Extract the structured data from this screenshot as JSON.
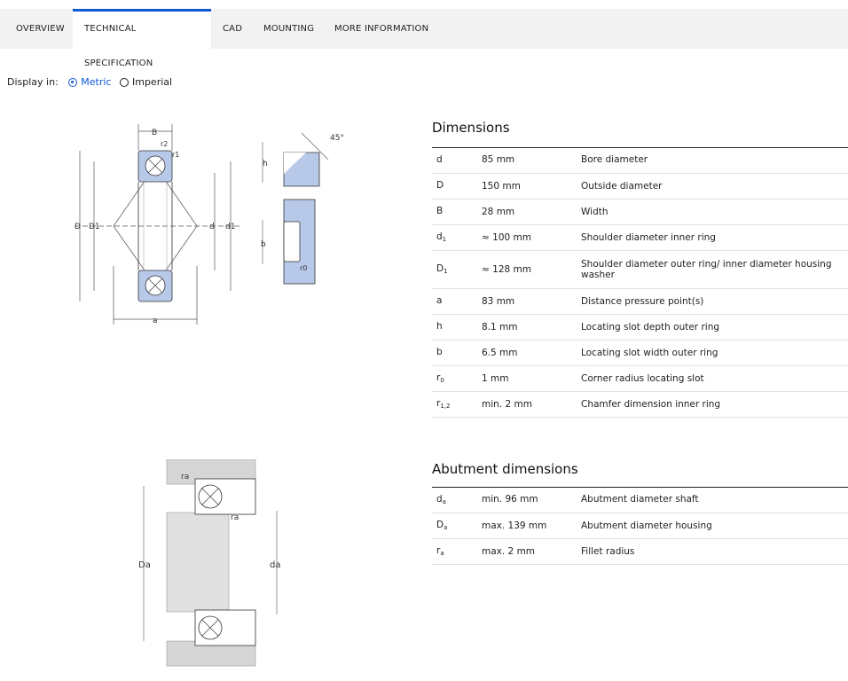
{
  "tabs": [
    {
      "label": "OVERVIEW",
      "active": false
    },
    {
      "label": "TECHNICAL SPECIFICATION",
      "active": true
    },
    {
      "label": "CAD",
      "active": false
    },
    {
      "label": "MOUNTING",
      "active": false
    },
    {
      "label": "MORE INFORMATION",
      "active": false
    }
  ],
  "display": {
    "label": "Display in:",
    "options": [
      {
        "label": "Metric",
        "selected": true
      },
      {
        "label": "Imperial",
        "selected": false
      }
    ]
  },
  "dimensions": {
    "title": "Dimensions",
    "rows": [
      {
        "sym": "d",
        "sub": "",
        "value": "85 mm",
        "desc": "Bore diameter"
      },
      {
        "sym": "D",
        "sub": "",
        "value": "150 mm",
        "desc": "Outside diameter"
      },
      {
        "sym": "B",
        "sub": "",
        "value": "28 mm",
        "desc": "Width"
      },
      {
        "sym": "d",
        "sub": "1",
        "value": "≈ 100 mm",
        "desc": "Shoulder diameter inner ring"
      },
      {
        "sym": "D",
        "sub": "1",
        "value": "≈ 128 mm",
        "desc": "Shoulder diameter outer ring/ inner diameter housing washer"
      },
      {
        "sym": "a",
        "sub": "",
        "value": "83 mm",
        "desc": "Distance pressure point(s)"
      },
      {
        "sym": "h",
        "sub": "",
        "value": "8.1 mm",
        "desc": "Locating slot depth outer ring"
      },
      {
        "sym": "b",
        "sub": "",
        "value": "6.5 mm",
        "desc": "Locating slot width outer ring"
      },
      {
        "sym": "r",
        "sub": "0",
        "value": "1 mm",
        "desc": "Corner radius locating slot"
      },
      {
        "sym": "r",
        "sub": "1,2",
        "value": "min. 2 mm",
        "desc": "Chamfer dimension inner ring"
      }
    ]
  },
  "abutment": {
    "title": "Abutment dimensions",
    "rows": [
      {
        "sym": "d",
        "sub": "a",
        "value": "min. 96 mm",
        "desc": "Abutment diameter shaft"
      },
      {
        "sym": "D",
        "sub": "a",
        "value": "max. 139 mm",
        "desc": "Abutment diameter housing"
      },
      {
        "sym": "r",
        "sub": "a",
        "value": "max. 2 mm",
        "desc": "Fillet radius"
      }
    ]
  },
  "drawing": {
    "labels": {
      "B": "B",
      "r2": "r2",
      "r1": "r1",
      "D": "D",
      "D1": "D1",
      "d": "d",
      "d1": "d1",
      "a": "a",
      "h": "h",
      "b": "b",
      "r0": "r0",
      "angle": "45°",
      "ra": "ra",
      "Da": "Da",
      "da": "da"
    }
  },
  "colors": {
    "accent": "#0f58d6",
    "ring_fill": "#b8c8e8",
    "tabbar": "#f2f2f2"
  }
}
